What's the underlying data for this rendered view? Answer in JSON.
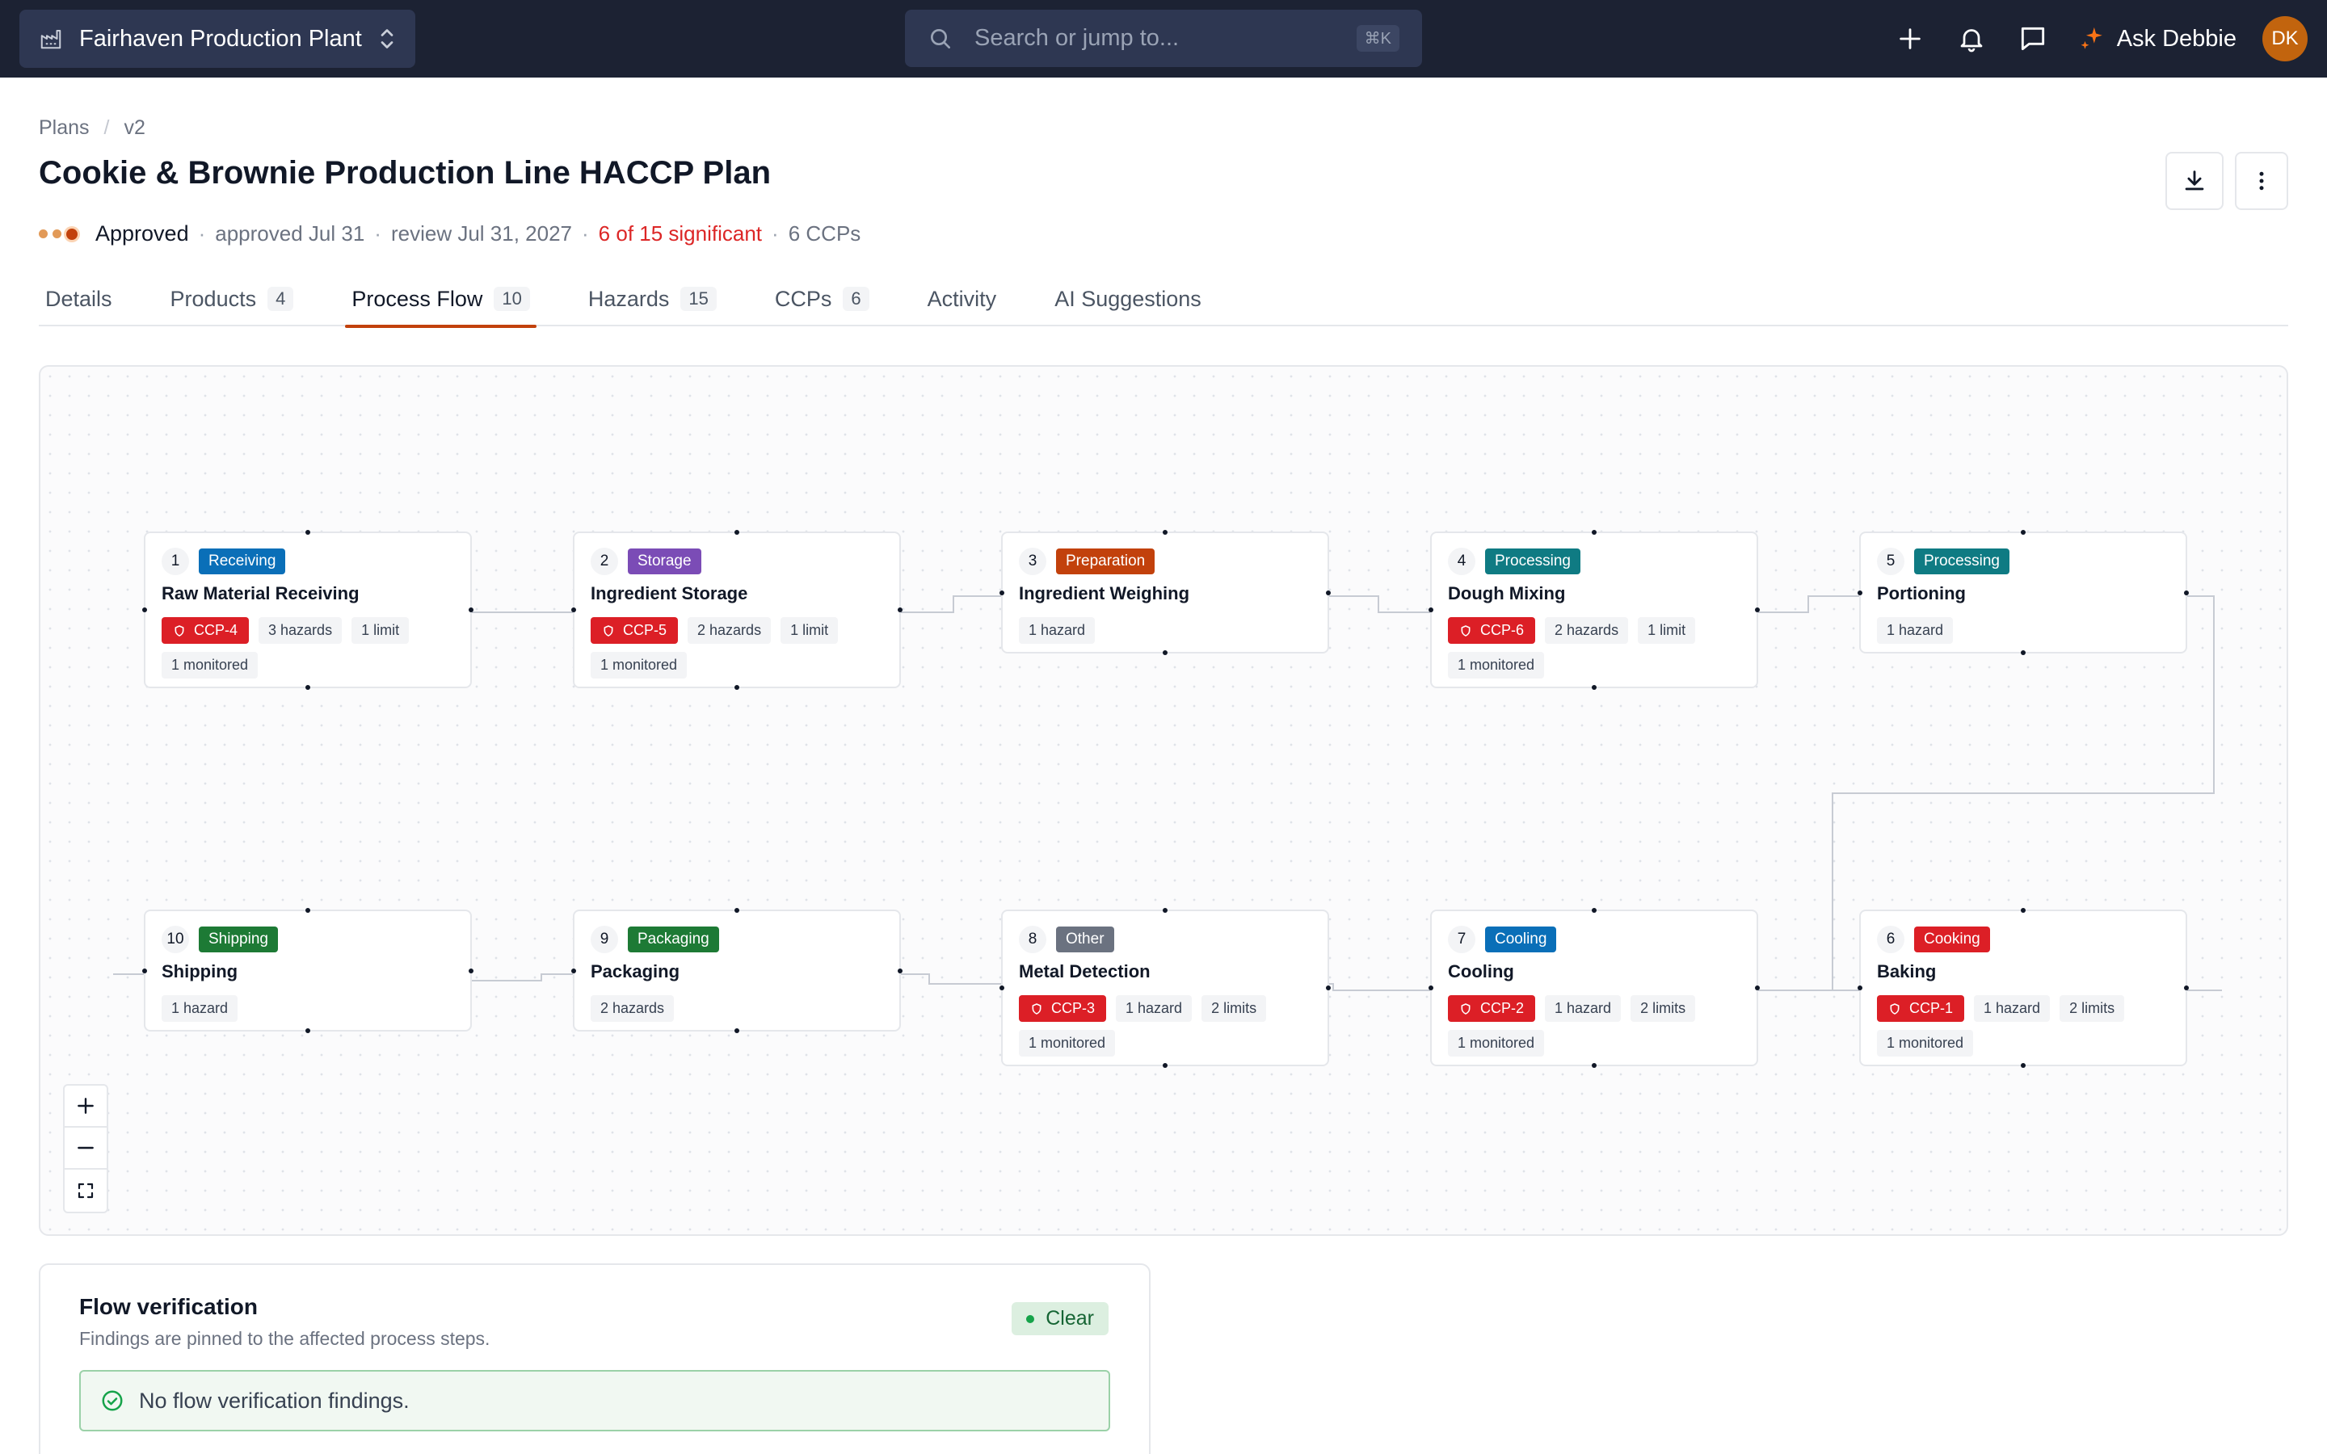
{
  "topbar": {
    "workspace_name": "Fairhaven Production Plant",
    "search_placeholder": "Search or jump to...",
    "search_shortcut": "⌘K",
    "ask_label": "Ask Debbie",
    "avatar_initials": "DK"
  },
  "breadcrumb": {
    "plans": "Plans",
    "version": "v2"
  },
  "page": {
    "title": "Cookie & Brownie Production Line HACCP Plan",
    "status": "Approved",
    "approved": "approved Jul 31",
    "review": "review Jul 31, 2027",
    "significant": "6 of 15 significant",
    "ccps": "6 CCPs"
  },
  "tabs": [
    {
      "label": "Details",
      "count": ""
    },
    {
      "label": "Products",
      "count": "4"
    },
    {
      "label": "Process Flow",
      "count": "10",
      "active": true
    },
    {
      "label": "Hazards",
      "count": "15"
    },
    {
      "label": "CCPs",
      "count": "6"
    },
    {
      "label": "Activity",
      "count": ""
    },
    {
      "label": "AI Suggestions",
      "count": ""
    }
  ],
  "category_colors": {
    "Receiving": "#0a6fb8",
    "Storage": "#7b4cb6",
    "Preparation": "#c2410c",
    "Processing": "#0f7b83",
    "Cooking": "#dc1f26",
    "Cooling": "#0a6fb8",
    "Other": "#6b7280",
    "Packaging": "#1d7a35",
    "Shipping": "#1d7a35"
  },
  "steps": [
    {
      "num": "1",
      "category": "Receiving",
      "name": "Raw Material Receiving",
      "ccp": "CCP-4",
      "tags": [
        "3 hazards",
        "1 limit",
        "1 monitored"
      ]
    },
    {
      "num": "2",
      "category": "Storage",
      "name": "Ingredient Storage",
      "ccp": "CCP-5",
      "tags": [
        "2 hazards",
        "1 limit",
        "1 monitored"
      ]
    },
    {
      "num": "3",
      "category": "Preparation",
      "name": "Ingredient Weighing",
      "ccp": "",
      "tags": [
        "1 hazard"
      ]
    },
    {
      "num": "4",
      "category": "Processing",
      "name": "Dough Mixing",
      "ccp": "CCP-6",
      "tags": [
        "2 hazards",
        "1 limit",
        "1 monitored"
      ]
    },
    {
      "num": "5",
      "category": "Processing",
      "name": "Portioning",
      "ccp": "",
      "tags": [
        "1 hazard"
      ]
    },
    {
      "num": "6",
      "category": "Cooking",
      "name": "Baking",
      "ccp": "CCP-1",
      "tags": [
        "1 hazard",
        "2 limits",
        "1 monitored"
      ]
    },
    {
      "num": "7",
      "category": "Cooling",
      "name": "Cooling",
      "ccp": "CCP-2",
      "tags": [
        "1 hazard",
        "2 limits",
        "1 monitored"
      ]
    },
    {
      "num": "8",
      "category": "Other",
      "name": "Metal Detection",
      "ccp": "CCP-3",
      "tags": [
        "1 hazard",
        "2 limits",
        "1 monitored"
      ]
    },
    {
      "num": "9",
      "category": "Packaging",
      "name": "Packaging",
      "ccp": "",
      "tags": [
        "2 hazards"
      ]
    },
    {
      "num": "10",
      "category": "Shipping",
      "name": "Shipping",
      "ccp": "",
      "tags": [
        "1 hazard"
      ]
    }
  ],
  "verification": {
    "title": "Flow verification",
    "subtitle": "Findings are pinned to the affected process steps.",
    "badge": "Clear",
    "message": "No flow verification findings."
  }
}
